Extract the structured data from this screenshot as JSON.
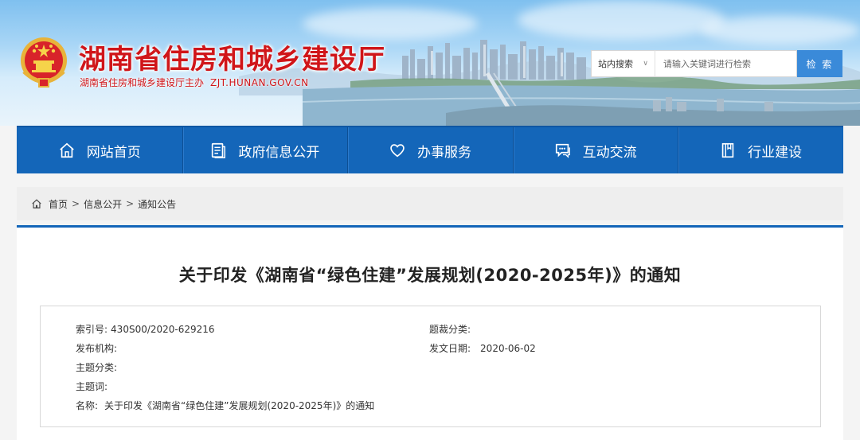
{
  "header": {
    "site_title": "湖南省住房和城乡建设厅",
    "site_subtitle": "湖南省住房和城乡建设厅主办",
    "domain": "ZJT.HUNAN.GOV.CN",
    "search": {
      "scope": "站内搜索",
      "placeholder": "请输入关键词进行检索",
      "button": "检 索"
    }
  },
  "nav": {
    "items": [
      {
        "label": "网站首页",
        "icon": "home-icon"
      },
      {
        "label": "政府信息公开",
        "icon": "document-icon"
      },
      {
        "label": "办事服务",
        "icon": "heart-icon"
      },
      {
        "label": "互动交流",
        "icon": "chat-icon"
      },
      {
        "label": "行业建设",
        "icon": "book-icon"
      }
    ]
  },
  "breadcrumb": {
    "items": [
      "首页",
      "信息公开",
      "通知公告"
    ],
    "separator": ">"
  },
  "article": {
    "title": "关于印发《湖南省“绿色住建”发展规划(2020-2025年)》的通知",
    "meta": {
      "index_label": "索引号:",
      "index_value": "430S00/2020-629216",
      "category_label": "题裁分类:",
      "category_value": "",
      "publisher_label": "发布机构:",
      "publisher_value": "",
      "date_label": "发文日期:",
      "date_value": "2020-06-02",
      "topic_label": "主题分类:",
      "topic_value": "",
      "keywords_label": "主题词:",
      "keywords_value": "",
      "name_label": "名称:",
      "name_value": "关于印发《湖南省“绿色住建”发展规划(2020-2025年)》的通知"
    }
  },
  "colors": {
    "brand_red": "#d0161a",
    "nav_blue": "#1466b9",
    "search_blue": "#3a8ad9"
  }
}
